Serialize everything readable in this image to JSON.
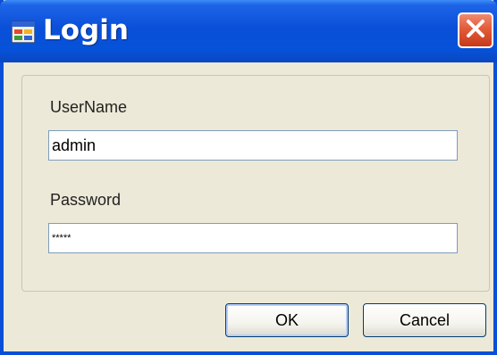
{
  "window": {
    "title": "Login",
    "icon": "app-form-icon",
    "close_icon": "close-icon",
    "accent_color": "#0A4FD8",
    "close_color": "#E25B3A"
  },
  "form": {
    "username_label": "UserName",
    "username_value": "admin",
    "password_label": "Password",
    "password_value": "*****"
  },
  "buttons": {
    "ok_label": "OK",
    "cancel_label": "Cancel"
  }
}
